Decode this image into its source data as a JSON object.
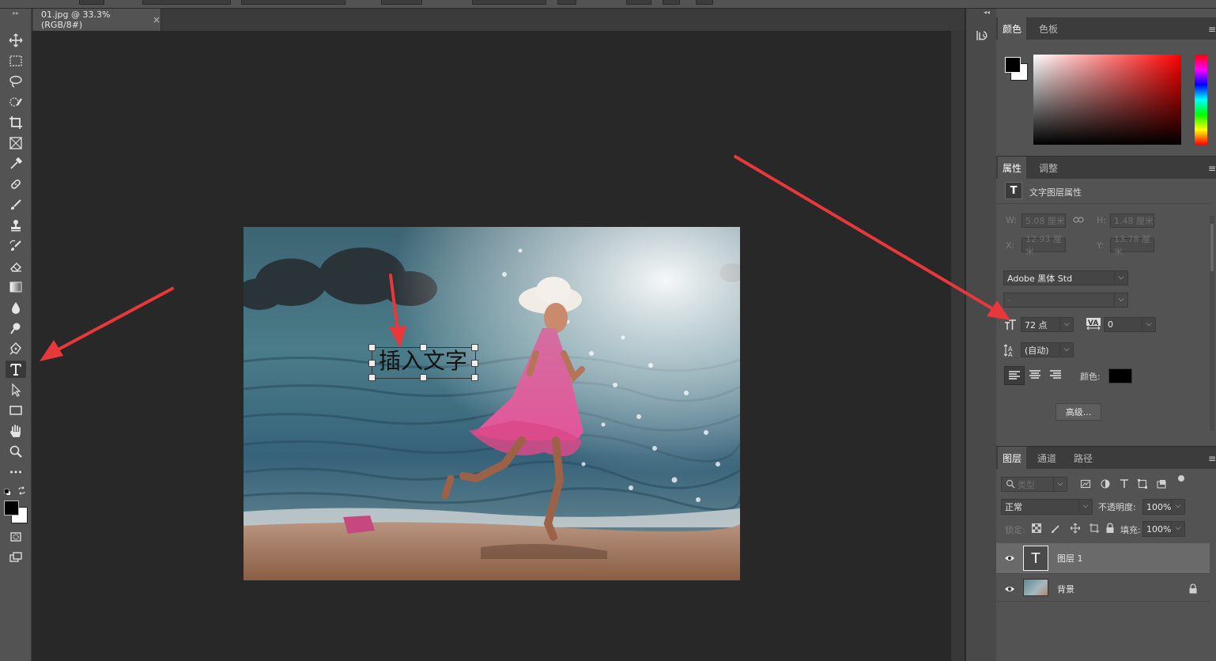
{
  "document": {
    "tab_title": "01.jpg @ 33.3%(RGB/8#)",
    "close_glyph": "×"
  },
  "canvas": {
    "inserted_text": "插入文字"
  },
  "tools": [
    "move-icon",
    "marquee-icon",
    "lasso-icon",
    "quick-select-icon",
    "crop-icon",
    "frame-icon",
    "eyedropper-icon",
    "healing-icon",
    "brush-icon",
    "stamp-icon",
    "history-brush-icon",
    "eraser-icon",
    "gradient-icon",
    "blur-icon",
    "dodge-icon",
    "pen-icon",
    "type-icon",
    "path-select-icon",
    "rectangle-icon",
    "hand-icon",
    "zoom-icon",
    "more-icon"
  ],
  "color_panel": {
    "tabs": [
      "颜色",
      "色板"
    ],
    "active_tab": 0,
    "foreground": "#000000",
    "background": "#ffffff",
    "hue": "#ff0000"
  },
  "properties_panel": {
    "tabs": [
      "属性",
      "调整"
    ],
    "active_tab": 0,
    "heading": "文字图层属性",
    "w_label": "W:",
    "w_value": "5.08 厘米",
    "h_label": "H:",
    "h_value": "1.48 厘米",
    "x_label": "X:",
    "x_value": "12.93 厘米",
    "y_label": "Y:",
    "y_value": "13.78 厘米",
    "font_family": "Adobe 黑体 Std",
    "font_style": "-",
    "font_size": "72 点",
    "tracking": "0",
    "leading": "(自动)",
    "color_label": "颜色:",
    "text_color": "#000000",
    "advanced_button": "高级..."
  },
  "layers_panel": {
    "tabs": [
      "图层",
      "通道",
      "路径"
    ],
    "active_tab": 0,
    "filter_placeholder": "类型",
    "blend_mode": "正常",
    "opacity_label": "不透明度:",
    "opacity_value": "100%",
    "lock_label": "锁定:",
    "fill_label": "填充:",
    "fill_value": "100%",
    "layers": [
      {
        "name": "图层 1",
        "type": "text",
        "selected": true
      },
      {
        "name": "背景",
        "type": "image",
        "locked": true
      }
    ]
  },
  "annotation_color": "#e8383b"
}
